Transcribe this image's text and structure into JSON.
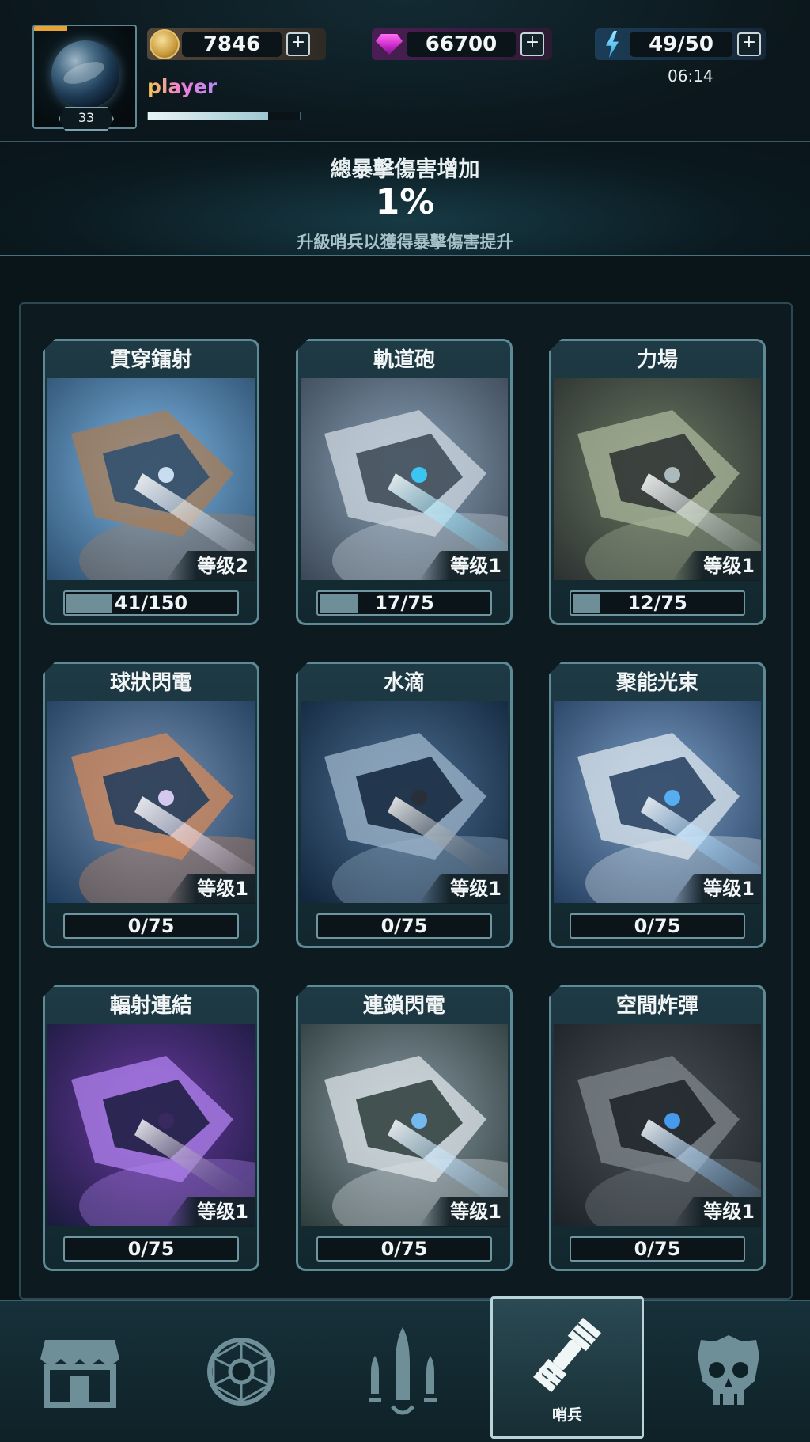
{
  "header": {
    "player_name": "player",
    "player_level": "33",
    "xp_fraction": 0.79,
    "gold": "7846",
    "gems": "66700",
    "energy": "49/50",
    "energy_timer": "06:14",
    "plus_label": "+"
  },
  "banner": {
    "title": "總暴擊傷害增加",
    "value": "1%",
    "subtitle": "升級哨兵以獲得暴擊傷害提升"
  },
  "cards": [
    {
      "name": "貫穿鐳射",
      "level_label": "等级2",
      "progress": "41/150",
      "progress_fraction": 0.27
    },
    {
      "name": "軌道砲",
      "level_label": "等级1",
      "progress": "17/75",
      "progress_fraction": 0.23
    },
    {
      "name": "力場",
      "level_label": "等级1",
      "progress": "12/75",
      "progress_fraction": 0.16
    },
    {
      "name": "球狀閃電",
      "level_label": "等级1",
      "progress": "0/75",
      "progress_fraction": 0
    },
    {
      "name": "水滴",
      "level_label": "等级1",
      "progress": "0/75",
      "progress_fraction": 0
    },
    {
      "name": "聚能光束",
      "level_label": "等级1",
      "progress": "0/75",
      "progress_fraction": 0
    },
    {
      "name": "輻射連結",
      "level_label": "等级1",
      "progress": "0/75",
      "progress_fraction": 0
    },
    {
      "name": "連鎖閃電",
      "level_label": "等级1",
      "progress": "0/75",
      "progress_fraction": 0
    },
    {
      "name": "空間炸彈",
      "level_label": "等级1",
      "progress": "0/75",
      "progress_fraction": 0
    }
  ],
  "nav": {
    "items": [
      {
        "icon": "shop-icon"
      },
      {
        "icon": "sphere-icon"
      },
      {
        "icon": "rockets-icon"
      },
      {
        "icon": "satellite-icon",
        "label": "哨兵",
        "active": true
      },
      {
        "icon": "skull-icon"
      }
    ]
  },
  "colors": {
    "accent": "#5e8a95",
    "gold_bar": "#e6a437",
    "gem": "#c726c6",
    "energy": "#2aa6e8"
  }
}
